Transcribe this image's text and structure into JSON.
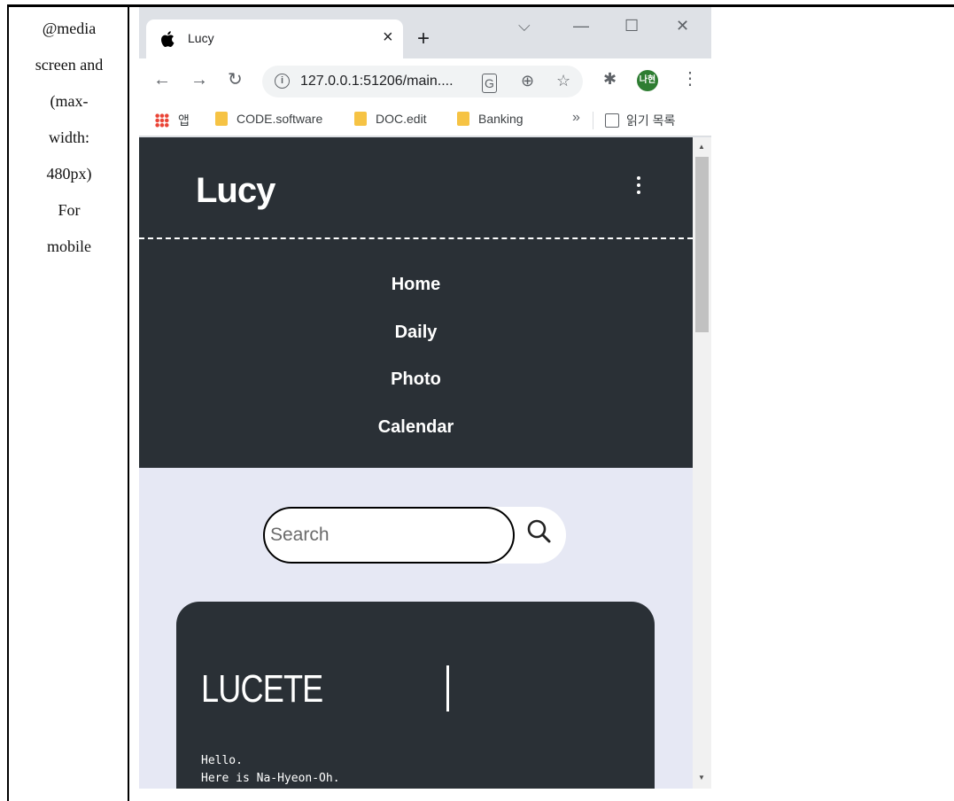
{
  "doc_label": {
    "lines": [
      "@media",
      "screen and",
      "(max-",
      "width:",
      "480px)",
      "For",
      "mobile"
    ]
  },
  "browser": {
    "tab_title": "Lucy",
    "url": "127.0.0.1:51206/main....",
    "avatar_text": "나현",
    "bookmarks": {
      "apps": "앱",
      "items": [
        "CODE.software",
        "DOC.edit",
        "Banking"
      ],
      "more": "»",
      "reading_list": "읽기 목록"
    }
  },
  "site": {
    "logo": "Lucy",
    "nav": [
      "Home",
      "Daily",
      "Photo",
      "Calendar"
    ],
    "search": {
      "placeholder": "Search"
    },
    "card": {
      "title": "LUCETE",
      "text_lines": [
        "Hello.",
        "Here is Na-Hyeon-Oh."
      ]
    }
  },
  "colors": {
    "header_bg": "#2a3036",
    "page_bg": "#e6e8f4",
    "avatar_bg": "#2e7d32"
  }
}
